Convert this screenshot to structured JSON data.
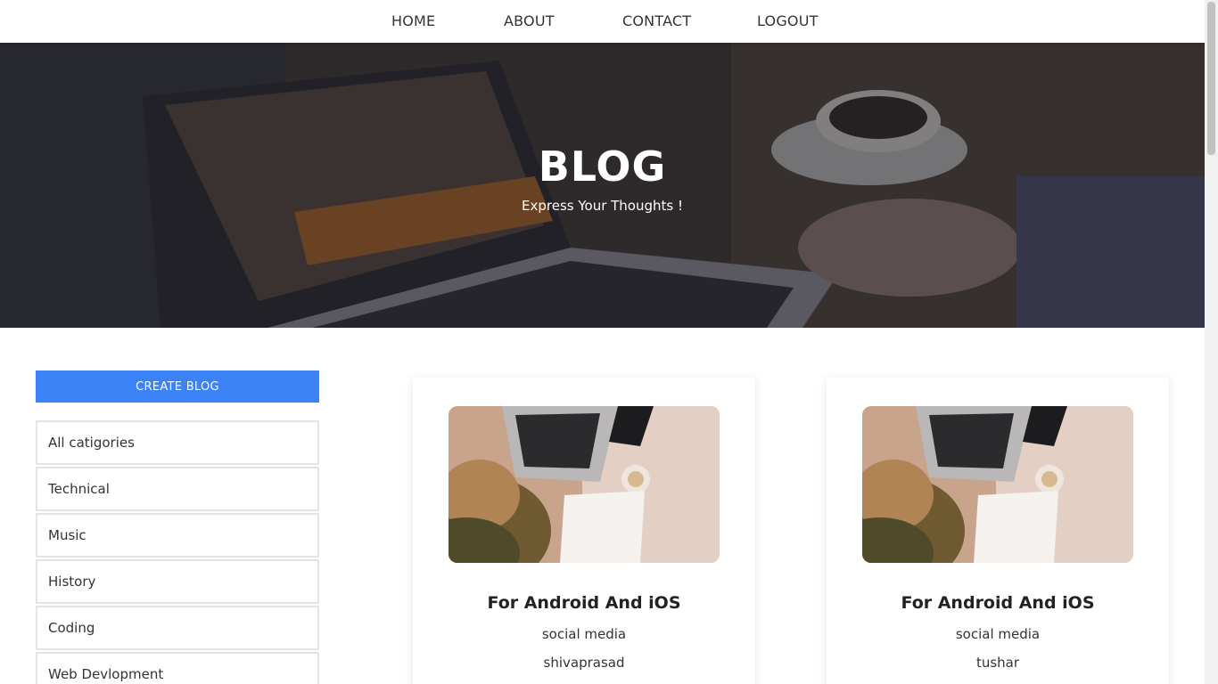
{
  "nav": {
    "items": [
      {
        "label": "HOME"
      },
      {
        "label": "ABOUT"
      },
      {
        "label": "CONTACT"
      },
      {
        "label": "LOGOUT"
      }
    ]
  },
  "hero": {
    "title": "BLOG",
    "subtitle": "Express Your Thoughts !",
    "image_icon": "laptop-coffee-photo"
  },
  "sidebar": {
    "create_label": "CREATE BLOG",
    "categories": [
      {
        "label": "All catigories"
      },
      {
        "label": "Technical"
      },
      {
        "label": "Music"
      },
      {
        "label": "History"
      },
      {
        "label": "Coding"
      },
      {
        "label": "Web Devlopment"
      }
    ]
  },
  "posts": [
    {
      "title": "For Android And iOS",
      "category": "social media",
      "author": "shivaprasad"
    },
    {
      "title": "For Android And iOS",
      "category": "social media",
      "author": "tushar"
    }
  ],
  "colors": {
    "accent": "#3b82f6",
    "hero_overlay": "#2d2c35"
  }
}
